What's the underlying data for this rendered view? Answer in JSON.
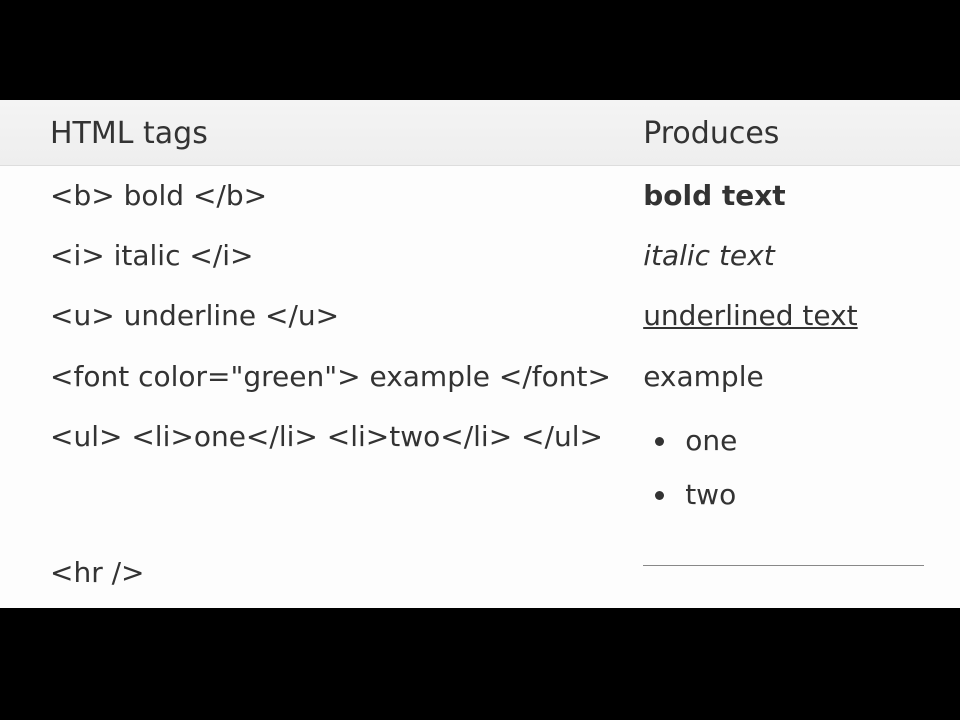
{
  "headers": {
    "left": "HTML tags",
    "right": "Produces"
  },
  "rows": {
    "bold": {
      "code": "<b> bold </b>",
      "output": "bold text"
    },
    "italic": {
      "code": "<i> italic </i>",
      "output": "italic text"
    },
    "underline": {
      "code": "<u> underline </u>",
      "output": "underlined text"
    },
    "font": {
      "code": "<font color=\"green\"> example </font>",
      "output": "example"
    },
    "list": {
      "code": "<ul> <li>one</li> <li>two</li> </ul>",
      "items": [
        "one",
        "two"
      ]
    },
    "hr": {
      "code": "<hr />"
    }
  }
}
